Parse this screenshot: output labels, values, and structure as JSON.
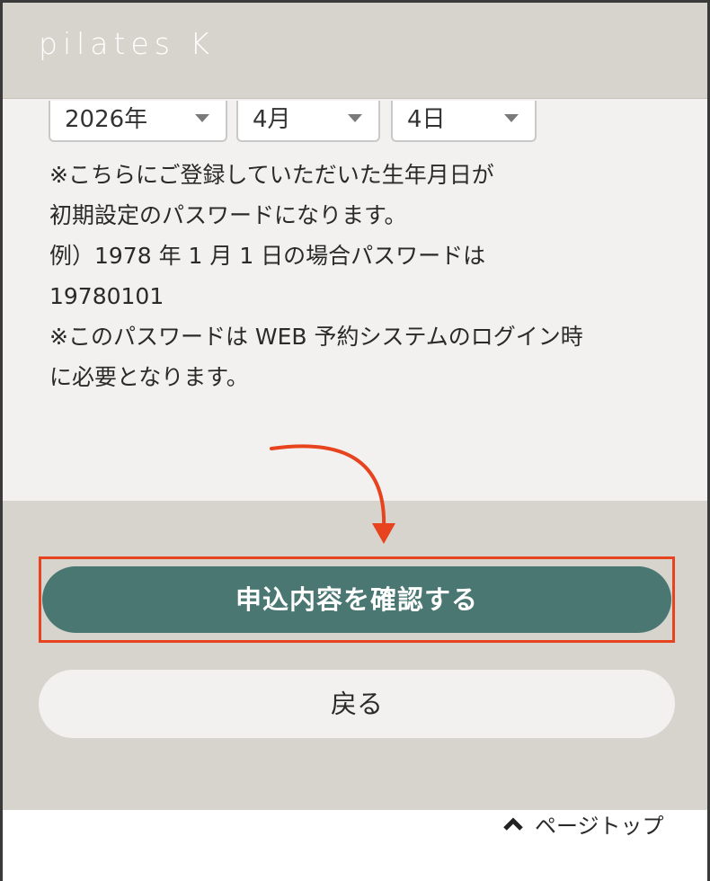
{
  "header": {
    "logo_text": "pilates K"
  },
  "birthday_selects": [
    {
      "value": "2026年"
    },
    {
      "value": "4月"
    },
    {
      "value": "4日"
    }
  ],
  "note_lines": [
    "※こちらにご登録していただいた生年月日が",
    "初期設定のパスワードになります。",
    "例）1978 年 1 月 1 日の場合パスワードは",
    "19780101",
    "※このパスワードは WEB 予約システムのログイン時",
    "に必要となります。"
  ],
  "actions": {
    "confirm_label": "申込内容を確認する",
    "back_label": "戻る"
  },
  "footer": {
    "pagetop_label": "ページトップ"
  },
  "colors": {
    "header_bg": "#d7d3cd",
    "content_bg": "#f2f1ef",
    "primary_button": "#4a7772",
    "highlight": "#e8431f"
  },
  "icons": {
    "caret": "chevron-down-icon",
    "pagetop": "chevron-up-icon",
    "annotation": "curved-arrow-icon"
  }
}
